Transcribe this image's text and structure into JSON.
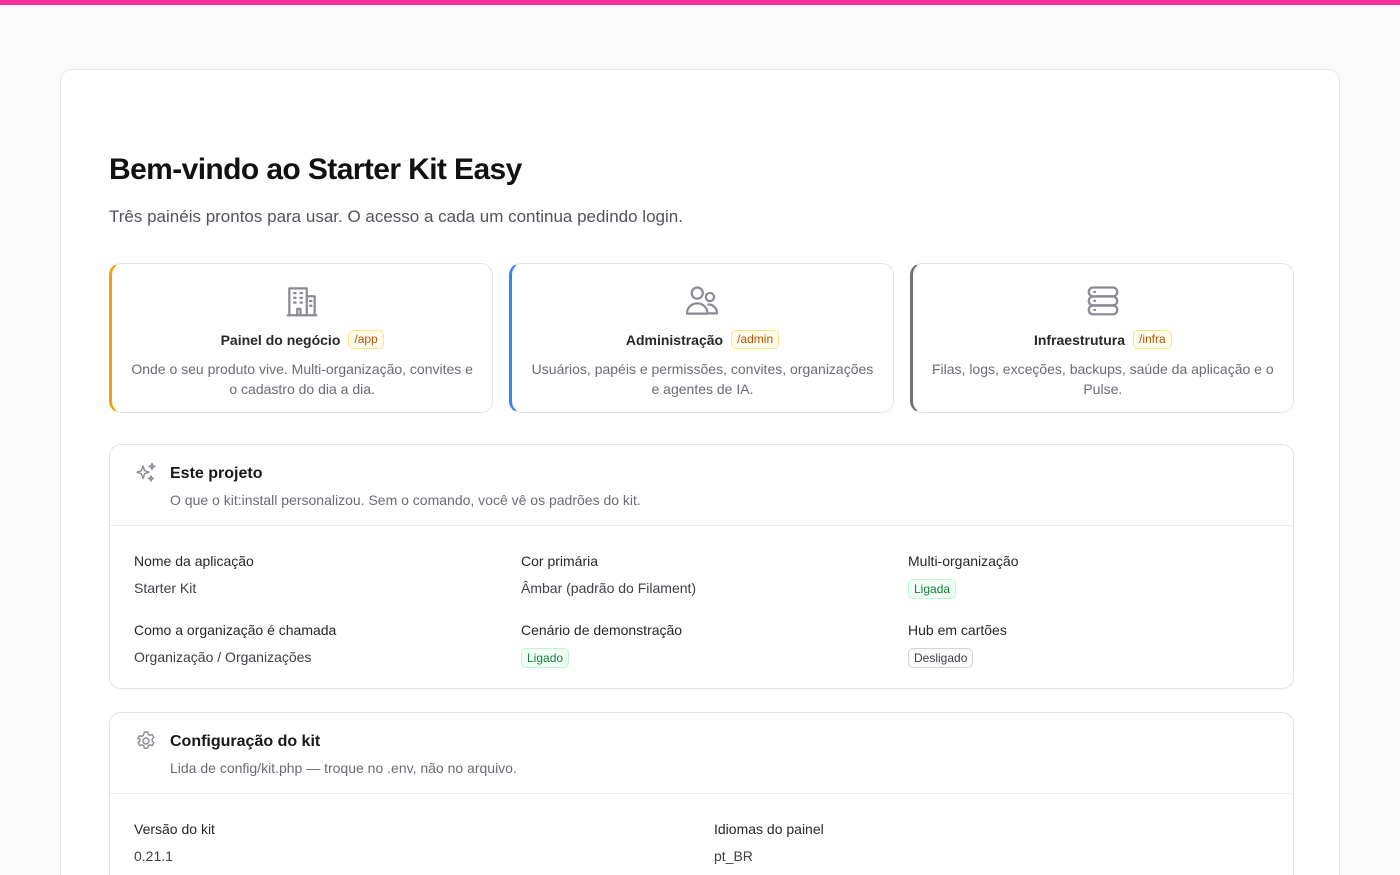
{
  "colors": {
    "accent_top": "#f72f9c",
    "panel_app": "#f59e0b",
    "panel_admin": "#3b82f6",
    "panel_infra": "#71717a",
    "badge_on": "#15803d"
  },
  "header": {
    "title": "Bem-vindo ao Starter Kit Easy",
    "subtitle": "Três painéis prontos para usar. O acesso a cada um continua pedindo login."
  },
  "panels": [
    {
      "icon": "building-icon",
      "title": "Painel do negócio",
      "path": "/app",
      "description": "Onde o seu produto vive. Multi-organização, convites e o cadastro do dia a dia."
    },
    {
      "icon": "users-icon",
      "title": "Administração",
      "path": "/admin",
      "description": "Usuários, papéis e permissões, convites, organizações e agentes de IA."
    },
    {
      "icon": "server-stack-icon",
      "title": "Infraestrutura",
      "path": "/infra",
      "description": "Filas, logs, exceções, backups, saúde da aplicação e o Pulse."
    }
  ],
  "project": {
    "icon": "sparkles-icon",
    "title": "Este projeto",
    "description": "O que o kit:install personalizou. Sem o comando, você vê os padrões do kit.",
    "fields": [
      {
        "label": "Nome da aplicação",
        "value": "Starter Kit",
        "type": "text"
      },
      {
        "label": "Cor primária",
        "value": "Âmbar (padrão do Filament)",
        "type": "text"
      },
      {
        "label": "Multi-organização",
        "value": "Ligada",
        "type": "on"
      },
      {
        "label": "Como a organização é chamada",
        "value": "Organização / Organizações",
        "type": "text"
      },
      {
        "label": "Cenário de demonstração",
        "value": "Ligado",
        "type": "on"
      },
      {
        "label": "Hub em cartões",
        "value": "Desligado",
        "type": "off"
      }
    ]
  },
  "config": {
    "icon": "gear-icon",
    "title": "Configuração do kit",
    "description": "Lida de config/kit.php — troque no .env, não no arquivo.",
    "fields": [
      {
        "label": "Versão do kit",
        "value": "0.21.1"
      },
      {
        "label": "Idiomas do painel",
        "value": "pt_BR"
      }
    ]
  }
}
